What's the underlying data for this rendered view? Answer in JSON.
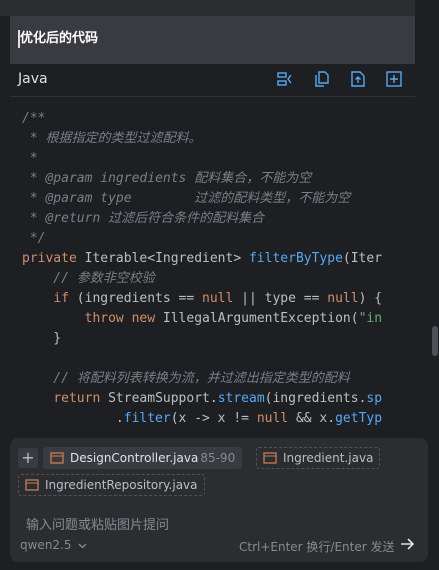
{
  "header": {
    "title": "优化后的代码"
  },
  "code_block": {
    "language": "Java",
    "toolbar_icons": [
      "insert-at-caret-icon",
      "copy-icon",
      "new-file-icon",
      "insert-icon"
    ],
    "lines": [
      [
        {
          "t": "/**",
          "c": "comment"
        }
      ],
      [
        {
          "t": " * 根据指定的类型过滤配料。",
          "c": "comment"
        }
      ],
      [
        {
          "t": " *",
          "c": "comment"
        }
      ],
      [
        {
          "t": " * ",
          "c": "comment"
        },
        {
          "t": "@param",
          "c": "doctag"
        },
        {
          "t": " ingredients",
          "c": "param"
        },
        {
          "t": " 配料集合，不能为空",
          "c": "comment"
        }
      ],
      [
        {
          "t": " * ",
          "c": "comment"
        },
        {
          "t": "@param",
          "c": "doctag"
        },
        {
          "t": " type",
          "c": "param"
        },
        {
          "t": "        过滤的配料类型，不能为空",
          "c": "comment"
        }
      ],
      [
        {
          "t": " * ",
          "c": "comment"
        },
        {
          "t": "@return",
          "c": "doctag"
        },
        {
          "t": " 过滤后符合条件的配料集合",
          "c": "comment"
        }
      ],
      [
        {
          "t": " */",
          "c": "comment"
        }
      ],
      [
        {
          "t": "private",
          "c": "kw"
        },
        {
          "t": " Iterable<Ingredient> ",
          "c": "plain"
        },
        {
          "t": "filterByType",
          "c": "fn"
        },
        {
          "t": "(Iter",
          "c": "plain"
        }
      ],
      [
        {
          "t": "    // 参数非空校验",
          "c": "comment"
        }
      ],
      [
        {
          "t": "    ",
          "c": "plain"
        },
        {
          "t": "if",
          "c": "kw"
        },
        {
          "t": " (ingredients == ",
          "c": "plain"
        },
        {
          "t": "null",
          "c": "kw"
        },
        {
          "t": " || type == ",
          "c": "plain"
        },
        {
          "t": "null",
          "c": "kw"
        },
        {
          "t": ") {",
          "c": "plain"
        }
      ],
      [
        {
          "t": "        ",
          "c": "plain"
        },
        {
          "t": "throw",
          "c": "kw"
        },
        {
          "t": " ",
          "c": "plain"
        },
        {
          "t": "new",
          "c": "kw"
        },
        {
          "t": " IllegalArgumentException(",
          "c": "plain"
        },
        {
          "t": "\"in",
          "c": "str"
        }
      ],
      [
        {
          "t": "    }",
          "c": "plain"
        }
      ],
      [
        {
          "t": "",
          "c": "plain"
        }
      ],
      [
        {
          "t": "    // 将配料列表转换为流，并过滤出指定类型的配料",
          "c": "comment"
        }
      ],
      [
        {
          "t": "    ",
          "c": "plain"
        },
        {
          "t": "return",
          "c": "kw"
        },
        {
          "t": " StreamSupport.",
          "c": "plain"
        },
        {
          "t": "stream",
          "c": "fn"
        },
        {
          "t": "(ingredients.",
          "c": "plain"
        },
        {
          "t": "sp",
          "c": "fn"
        }
      ],
      [
        {
          "t": "            .",
          "c": "plain"
        },
        {
          "t": "filter",
          "c": "fn"
        },
        {
          "t": "(x -> x != ",
          "c": "plain"
        },
        {
          "t": "null",
          "c": "kw"
        },
        {
          "t": " && x.",
          "c": "plain"
        },
        {
          "t": "getTyp",
          "c": "fn"
        }
      ]
    ]
  },
  "input": {
    "add_label": "+",
    "chips": [
      {
        "label": "DesignController.java",
        "range": "85-90"
      },
      {
        "label": "Ingredient.java",
        "range": ""
      },
      {
        "label": "IngredientRepository.java",
        "range": ""
      }
    ],
    "placeholder": "输入问题或粘贴图片提问",
    "model": "qwen2.5",
    "send_hint": "Ctrl+Enter 换行/Enter 发送"
  }
}
